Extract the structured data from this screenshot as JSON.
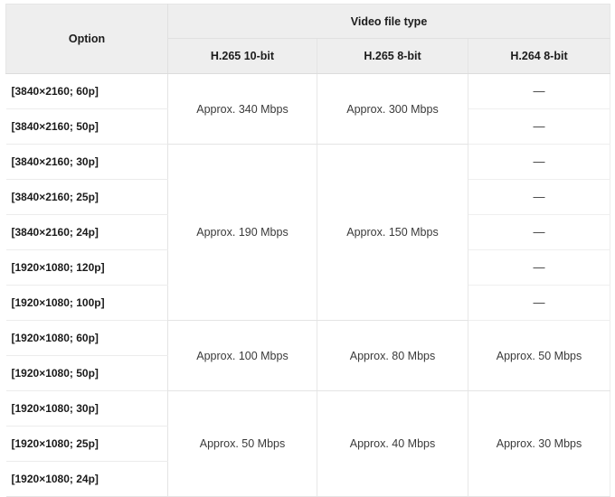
{
  "table": {
    "headers": {
      "option": "Option",
      "group": "Video file type",
      "columns": [
        "H.265 10-bit",
        "H.265 8-bit",
        "H.264 8-bit"
      ]
    },
    "rows": [
      {
        "option": "[3840×2160; 60p]"
      },
      {
        "option": "[3840×2160; 50p]"
      },
      {
        "option": "[3840×2160; 30p]"
      },
      {
        "option": "[3840×2160; 25p]"
      },
      {
        "option": "[3840×2160; 24p]"
      },
      {
        "option": "[1920×1080; 120p]"
      },
      {
        "option": "[1920×1080; 100p]"
      },
      {
        "option": "[1920×1080; 60p]"
      },
      {
        "option": "[1920×1080; 50p]"
      },
      {
        "option": "[1920×1080; 30p]"
      },
      {
        "option": "[1920×1080; 25p]"
      },
      {
        "option": "[1920×1080; 24p]"
      }
    ],
    "bitrate_groups": [
      {
        "h265_10bit": "Approx. 340 Mbps",
        "h265_8bit": "Approx. 300 Mbps",
        "rowspan": 2
      },
      {
        "h265_10bit": "Approx. 190 Mbps",
        "h265_8bit": "Approx. 150 Mbps",
        "rowspan": 5
      },
      {
        "h265_10bit": "Approx. 100 Mbps",
        "h265_8bit": "Approx. 80 Mbps",
        "rowspan": 2
      },
      {
        "h265_10bit": "Approx. 50 Mbps",
        "h265_8bit": "Approx. 40 Mbps",
        "rowspan": 3
      }
    ],
    "h264_groups": [
      {
        "value": "—",
        "rowspan": 1
      },
      {
        "value": "—",
        "rowspan": 1
      },
      {
        "value": "—",
        "rowspan": 1
      },
      {
        "value": "—",
        "rowspan": 1
      },
      {
        "value": "—",
        "rowspan": 1
      },
      {
        "value": "—",
        "rowspan": 1
      },
      {
        "value": "—",
        "rowspan": 1
      },
      {
        "value": "Approx. 50 Mbps",
        "rowspan": 2
      },
      {
        "value": "Approx. 30 Mbps",
        "rowspan": 3
      }
    ],
    "colors": {
      "header_background": "#eeeeee",
      "body_background": "#ffffff",
      "grid_line": "#e8e8e8",
      "label_text": "#1a1a1a",
      "data_text": "#3a3a3a"
    }
  }
}
